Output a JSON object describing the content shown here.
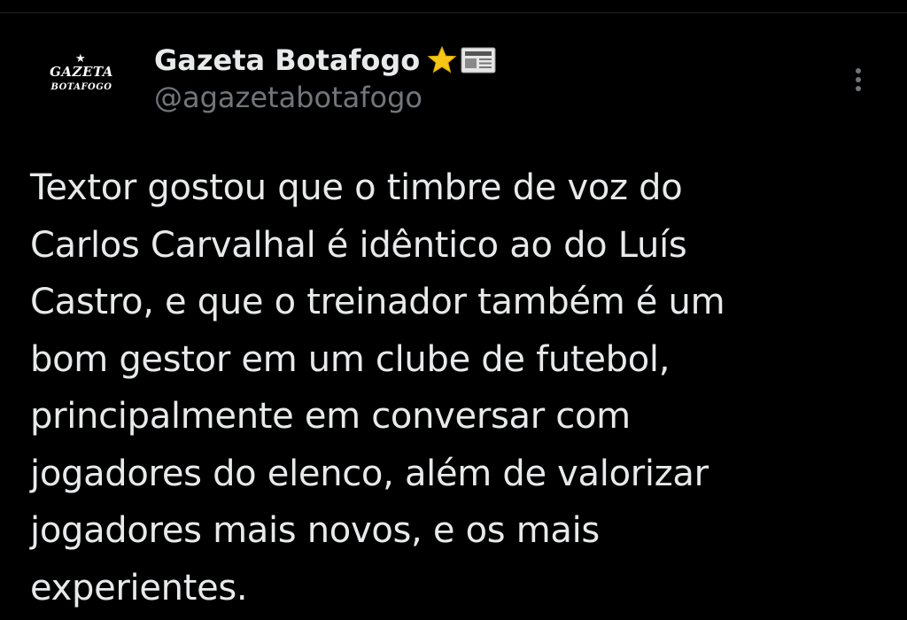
{
  "tweet": {
    "author": {
      "display_name": "Gazeta Botafogo",
      "handle": "@agazetabotafogo",
      "avatar": {
        "logo_line1": "GAZETA",
        "logo_line2": "BOTAFOGO",
        "logo_mark": "★"
      },
      "name_emojis": [
        "star-icon",
        "newspaper-icon"
      ]
    },
    "text": "Textor gostou que o timbre de voz do\nCarlos Carvalhal é idêntico ao do Luís\nCastro, e que o treinador também é um\nbom gestor em um clube de futebol,\nprincipalmente em conversar com\njogadores do elenco, além de valorizar\njogadores mais novos, e os mais\nexperientes.",
    "more_menu_icon": "more-vertical-icon"
  },
  "colors": {
    "background": "#000000",
    "primary_text": "#e7e9ea",
    "secondary_text": "#71767b",
    "star": "#f5c518"
  }
}
